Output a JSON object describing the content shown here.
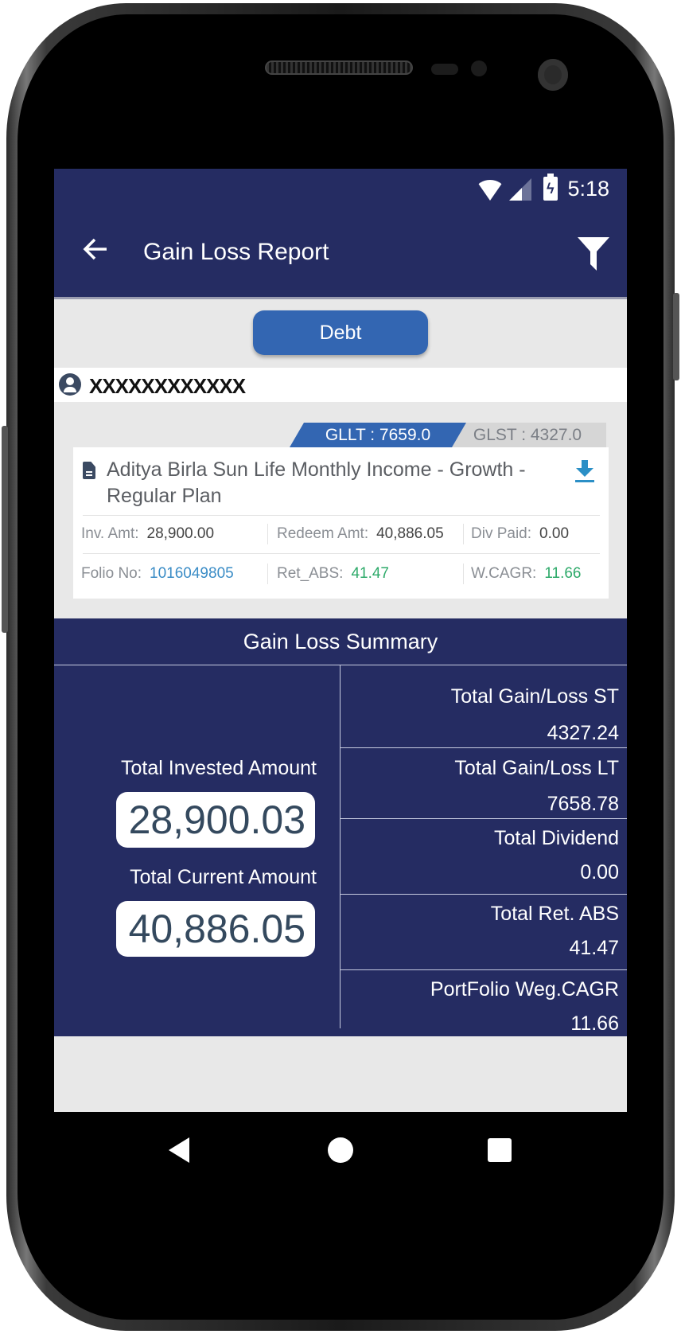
{
  "status_bar": {
    "time": "5:18",
    "icons": [
      "wifi-icon",
      "signal-icon",
      "battery-charging-icon"
    ]
  },
  "app_bar": {
    "title": "Gain Loss Report",
    "back_icon": "arrow-left-icon",
    "filter_icon": "filter-icon"
  },
  "category_button": {
    "label": "Debt"
  },
  "user": {
    "name": "XXXXXXXXXXXX"
  },
  "gain_tabs": {
    "gllt": "GLLT : 7659.0",
    "glst": "GLST : 4327.0"
  },
  "fund_card": {
    "fund_name": "Aditya Birla Sun Life Monthly Income - Growth - Regular Plan",
    "inv_amt_label": "Inv. Amt:",
    "inv_amt": "28,900.00",
    "redeem_amt_label": "Redeem Amt:",
    "redeem_amt": "40,886.05",
    "div_paid_label": "Div Paid:",
    "div_paid": "0.00",
    "folio_label": "Folio No:",
    "folio": "1016049805",
    "ret_abs_label": "Ret_ABS:",
    "ret_abs": "41.47",
    "wcagr_label": "W.CAGR:",
    "wcagr": "11.66"
  },
  "summary": {
    "title": "Gain Loss Summary",
    "total_invested_label": "Total Invested Amount",
    "total_invested": "28,900.03",
    "total_current_label": "Total Current Amount",
    "total_current": "40,886.05",
    "items": [
      {
        "label": "Total Gain/Loss ST",
        "value": "4327.24"
      },
      {
        "label": "Total Gain/Loss LT",
        "value": "7658.78"
      },
      {
        "label": "Total Dividend",
        "value": "0.00"
      },
      {
        "label": "Total Ret. ABS",
        "value": "41.47"
      },
      {
        "label": "PortFolio Weg.CAGR",
        "value": "11.66"
      }
    ]
  },
  "colors": {
    "primary": "#252c62",
    "accent": "#3366b2",
    "link": "#3a8cc6",
    "positive": "#2eaa6a",
    "background": "#e8e8e8"
  }
}
